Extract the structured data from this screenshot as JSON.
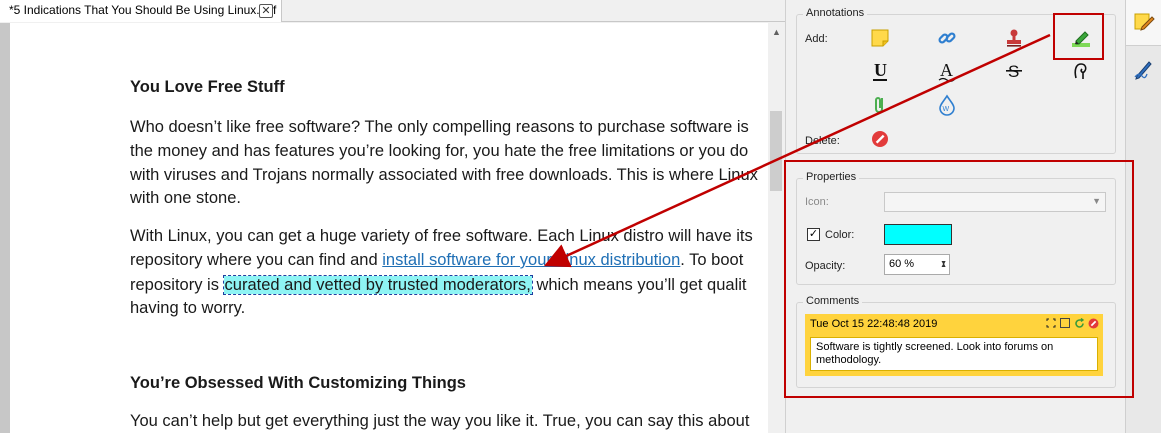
{
  "tab": {
    "title": "*5 Indications That You Should Be Using Linux.pdf",
    "close_glyph": "✕"
  },
  "document": {
    "heading1": "You Love Free Stuff",
    "p1": [
      "Who doesn’t like free software? The only compelling reasons to purchase software is",
      "the money and has features you’re looking for, you hate the free limitations or you do",
      "with viruses and Trojans normally associated with free downloads. This is where Linux",
      "with one stone."
    ],
    "p2_l1": "With Linux, you can get a huge variety of free software. Each Linux distro will have its",
    "p2_l2_pre": "repository where you can find and ",
    "p2_l2_link": "install software for your Linux distribution",
    "p2_l2_post": ". To boot",
    "p2_l3_pre": "repository is ",
    "p2_l3_highlight": "curated and vetted by trusted moderators,",
    "p2_l3_post": " which means you’ll get qualit",
    "p2_l4": "having to worry.",
    "heading2": "You’re Obsessed With Customizing Things",
    "p3": "You can’t help but get everything just the way you like it. True, you can say this about"
  },
  "annotations": {
    "title": "Annotations",
    "add_label": "Add:",
    "delete_label": "Delete:"
  },
  "properties": {
    "title": "Properties",
    "icon_label": "Icon:",
    "color_label": "Color:",
    "color_checked": true,
    "color_value": "#00ffff",
    "opacity_label": "Opacity:",
    "opacity_value": "60 %"
  },
  "comments": {
    "title": "Comments",
    "date": "Tue Oct 15 22:48:48 2019",
    "text": "Software is tightly screened. Look into forums on methodology."
  },
  "colors": {
    "highlight": "#8ef4f4",
    "link": "#1f6fb5",
    "callout": "#c00000",
    "note_bg": "#ffd33d"
  }
}
